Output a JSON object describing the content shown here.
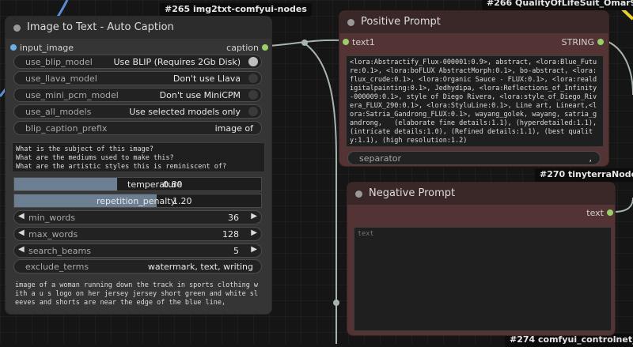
{
  "badges": {
    "n265": "#265 img2txt-comfyui-nodes",
    "n266": "#266 QualityOfLifeSuit_Omar92",
    "n270": "#270 tinyterraNodes",
    "n274": "#274 comfyui_controlnet_aux"
  },
  "caption_node": {
    "title": "Image to Text - Auto Caption",
    "input_label": "input_image",
    "output_label": "caption",
    "toggles": [
      {
        "label": "use_blip_model",
        "value": "Use BLIP (Requires 2Gb Disk)",
        "on": true
      },
      {
        "label": "use_llava_model",
        "value": "Don't use Llava",
        "on": false
      },
      {
        "label": "use_mini_pcm_model",
        "value": "Don't use MiniCPM",
        "on": false
      },
      {
        "label": "use_all_models",
        "value": "Use selected models only",
        "on": false
      }
    ],
    "prefix": {
      "label": "blip_caption_prefix",
      "value": "image of"
    },
    "questions": "What is the subject of this image?\nWhat are the mediums used to make this?\nWhat are the artistic styles this is reminiscent of?\nWhich famous artists is this reminiscent of?",
    "temperature": {
      "label": "temperature",
      "value": "0.80",
      "fraction": 0.8
    },
    "repetition": {
      "label": "repetition_penalty",
      "value": "1.20",
      "fraction": 0.6
    },
    "numbers": [
      {
        "label": "min_words",
        "value": "36"
      },
      {
        "label": "max_words",
        "value": "128"
      },
      {
        "label": "search_beams",
        "value": "5"
      }
    ],
    "exclude": {
      "label": "exclude_terms",
      "value": "watermark, text, writing"
    },
    "output_text": "image of a woman running down the track in sports clothing with a u s logo on her jersey jersey short green and white sleeves and shorts are near the edge of the blue line,"
  },
  "positive_node": {
    "title": "Positive Prompt",
    "input_label": "text1",
    "output_label": "STRING",
    "text": "<lora:Abstractify_Flux-000001:0.9>, abstract, <lora:Blue_Future:0.1>, <lora:boFLUX AbstractMorph:0.1>, bo-abstract, <lora:flux_crude:0.1>, <lora:Organic Sauce - FLUX:0.1>, <lora:realdigitalpainting:0.1>, Jedhydipa, <lora:Reflections_of_Infinity-000009:0.1>, style of Diego Rivera, <lora:style_of_Diego_Rivera_FLUX_290:0.1>, <lora:StyluLine:0.1>, Line art, Lineart,<lora:Satria_Gandrong_FLUX:0.1>, wayang_golek, wayang, satria_gandrong,   (elaborate fine details:1.1), (hyperdetailed:1.1), (intricate details:1.0), (Refined details:1.1), (best quality:1.1), (high resolution:1.2)",
    "separator": {
      "label": "separator",
      "value": ","
    }
  },
  "negative_node": {
    "title": "Negative Prompt",
    "output_label": "text",
    "placeholder": "text"
  },
  "colors": {
    "node_body": "#353535",
    "prompt_body": "#533333",
    "prompt_title": "#3a2727",
    "wire": "#a7b4ac",
    "slot_green": "#9ad06a",
    "slot_blue": "#6ab0e6"
  }
}
